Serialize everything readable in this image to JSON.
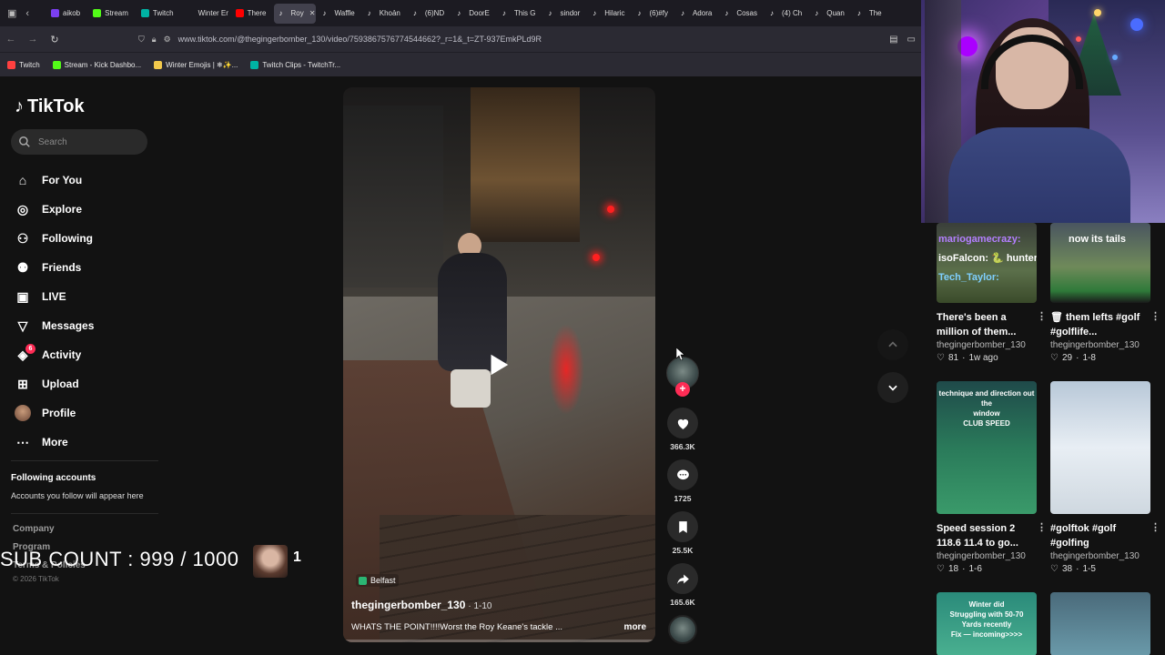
{
  "browser": {
    "tabs": [
      {
        "label": "aikob",
        "fav": "#7b3ff2"
      },
      {
        "label": "Stream",
        "fav": "#53fc18"
      },
      {
        "label": "Twitch",
        "fav": "#00b3a4"
      },
      {
        "label": "Winter Em",
        "fav": ""
      },
      {
        "label": "There",
        "fav": "#ff0000"
      },
      {
        "label": "Roy",
        "fav": "#ffffff",
        "active": true
      },
      {
        "label": "Waffle",
        "fav": "#ffffff"
      },
      {
        "label": "Khoản",
        "fav": "#ffffff"
      },
      {
        "label": "(6)ND",
        "fav": "#ffffff"
      },
      {
        "label": "DoorE",
        "fav": "#ffffff"
      },
      {
        "label": "This G",
        "fav": "#ffffff"
      },
      {
        "label": "sindor",
        "fav": "#ffffff"
      },
      {
        "label": "Hilaric",
        "fav": "#ffffff"
      },
      {
        "label": "(6)#fy",
        "fav": "#ffffff"
      },
      {
        "label": "Adora",
        "fav": "#ffffff"
      },
      {
        "label": "Cosas",
        "fav": "#ffffff"
      },
      {
        "label": "(4) Ch",
        "fav": "#ffffff"
      },
      {
        "label": "Quan",
        "fav": "#ffffff"
      },
      {
        "label": "The",
        "fav": "#ffffff"
      }
    ],
    "url": "www.tiktok.com/@thegingerbomber_130/video/7593867576774544662?_r=1&_t=ZT-937EmkPLd9R",
    "bookmarks": [
      {
        "label": "Twitch",
        "fav": "#ff4040"
      },
      {
        "label": "Stream - Kick Dashbo...",
        "fav": "#53fc18"
      },
      {
        "label": "Winter Emojis | ❄✨...",
        "fav": "#f2c94c"
      },
      {
        "label": "Twitch Clips - TwitchTr...",
        "fav": "#00b3a4"
      }
    ]
  },
  "sidebar": {
    "logo": "TikTok",
    "search_placeholder": "Search",
    "items": [
      {
        "label": "For You",
        "icon": "home-icon"
      },
      {
        "label": "Explore",
        "icon": "compass-icon"
      },
      {
        "label": "Following",
        "icon": "following-icon"
      },
      {
        "label": "Friends",
        "icon": "friends-icon"
      },
      {
        "label": "LIVE",
        "icon": "live-icon"
      },
      {
        "label": "Messages",
        "icon": "messages-icon"
      },
      {
        "label": "Activity",
        "icon": "inbox-icon",
        "badge": "6"
      },
      {
        "label": "Upload",
        "icon": "upload-icon"
      },
      {
        "label": "Profile",
        "icon": "avatar"
      },
      {
        "label": "More",
        "icon": "more-icon"
      }
    ],
    "following_title": "Following accounts",
    "following_sub": "Accounts you follow will appear here",
    "footer": [
      "Company",
      "Program",
      "Terms & Policies"
    ],
    "copyright": "© 2026 TikTok"
  },
  "overlay": {
    "sub_count": "SUB COUNT : 999 / 1000",
    "count_badge": "1"
  },
  "video": {
    "location": "Belfast",
    "author": "thegingerbomber_130",
    "date": "· 1-10",
    "caption": "WHATS THE POINT!!!!Worst the Roy Keane's tackle ...",
    "more": "more",
    "likes": "366.3K",
    "comments": "1725",
    "saves": "25.5K",
    "shares": "165.6K"
  },
  "related": [
    {
      "title": "There's been a million of them...",
      "user": "thegingerbomber_130",
      "likes": "81",
      "date": "1w ago",
      "overlay": [
        "mariogamecrazy: ",
        "isoFalcon: 🐍 hunter",
        "Tech_Taylor:"
      ]
    },
    {
      "title": "🗑 them lefts #golf #golflife...",
      "user": "thegingerbomber_130",
      "likes": "29",
      "date": "1-8",
      "overlay": [
        "now its tails"
      ]
    },
    {
      "title": "Speed session 2 118.6 11.4 to go...",
      "user": "thegingerbomber_130",
      "likes": "18",
      "date": "1-6",
      "overlay": [
        "technique and direction out the",
        "window",
        "CLUB SPEED"
      ]
    },
    {
      "title": "#golftok #golf #golfing",
      "user": "thegingerbomber_130",
      "likes": "38",
      "date": "1-5",
      "overlay": []
    },
    {
      "title": "",
      "user": "",
      "likes": "",
      "date": "",
      "overlay": [
        "Winter did",
        "Struggling with 50-70",
        "Yards recently",
        "Fix — incoming>>>>"
      ]
    },
    {
      "title": "",
      "user": "",
      "likes": "",
      "date": "",
      "overlay": []
    }
  ]
}
